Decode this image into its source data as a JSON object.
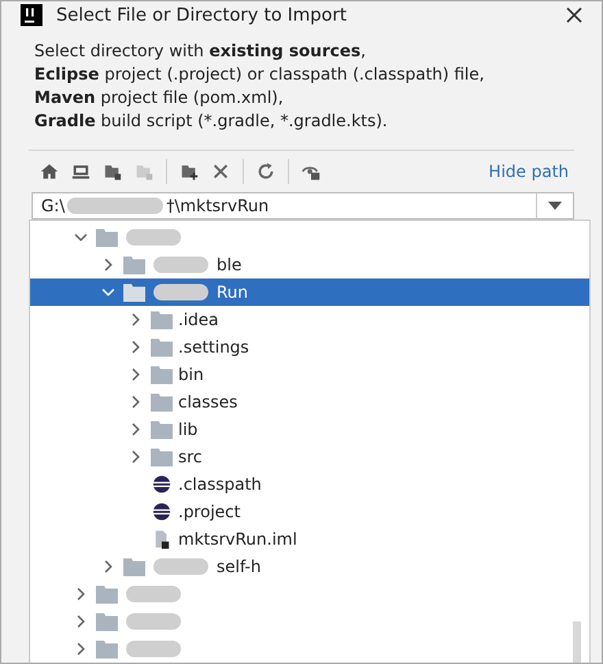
{
  "window": {
    "title": "Select File or Directory to Import"
  },
  "description": [
    "Select directory with **existing sources**,",
    "**Eclipse** project (.project) or classpath (.classpath) file,",
    "**Maven** project file (pom.xml),",
    "**Gradle** build script (*.gradle, *.gradle.kts)."
  ],
  "toolbar": {
    "hide_path_link": "Hide path"
  },
  "path_field": {
    "value_start": "G:\\",
    "redacted": true,
    "value_end": "†\\mktsrvRun"
  },
  "tree": [
    {
      "kind": "folder",
      "redacted": true,
      "expanded": true,
      "selected": false,
      "children": [
        {
          "kind": "folder",
          "redacted": true,
          "label": "ble",
          "expanded": false,
          "selected": false
        },
        {
          "kind": "folder",
          "redacted": true,
          "label": "Run",
          "expanded": true,
          "selected": true,
          "children": [
            {
              "kind": "folder",
              "label": ".idea",
              "expanded": false,
              "selected": false
            },
            {
              "kind": "folder",
              "label": ".settings",
              "expanded": false,
              "selected": false
            },
            {
              "kind": "folder",
              "label": "bin",
              "expanded": false,
              "selected": false
            },
            {
              "kind": "folder",
              "label": "classes",
              "expanded": false,
              "selected": false
            },
            {
              "kind": "folder",
              "label": "lib",
              "expanded": false,
              "selected": false
            },
            {
              "kind": "folder",
              "label": "src",
              "expanded": false,
              "selected": false
            },
            {
              "kind": "eclipse",
              "label": ".classpath",
              "selected": false
            },
            {
              "kind": "eclipse",
              "label": ".project",
              "selected": false
            },
            {
              "kind": "module",
              "label": "mktsrvRun.iml",
              "selected": false
            }
          ]
        },
        {
          "kind": "folder",
          "label": "self-h",
          "redacted": true,
          "expanded": false,
          "selected": false
        }
      ]
    },
    {
      "kind": "folder",
      "redacted": true,
      "expanded": false,
      "selected": false
    },
    {
      "kind": "folder",
      "redacted": true,
      "expanded": false,
      "selected": false
    },
    {
      "kind": "folder",
      "redacted": true,
      "expanded": false,
      "selected": false
    }
  ]
}
